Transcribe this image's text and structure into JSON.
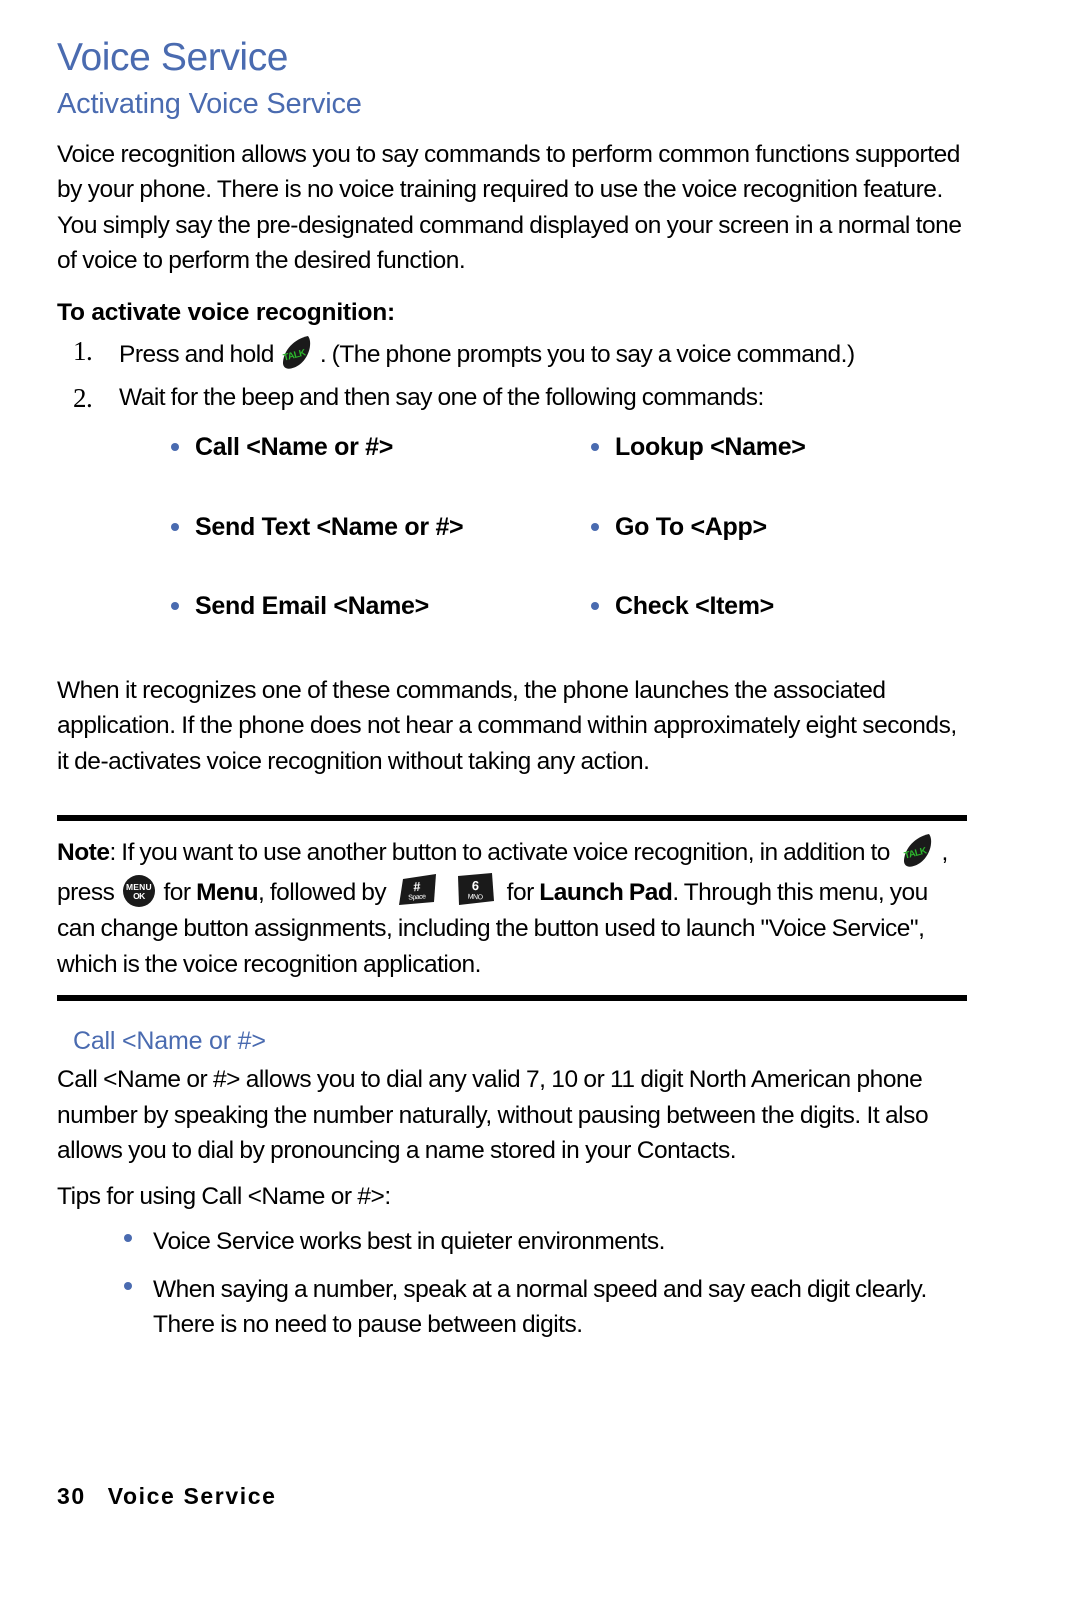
{
  "page": {
    "title": "Voice Service",
    "section_heading": "Activating Voice Service",
    "intro_paragraph": "Voice recognition allows you to say commands to perform common functions supported by your phone. There is no voice training required to use the voice recognition feature. You simply say the pre-designated command displayed on your screen in a normal tone of voice to perform the desired function.",
    "procedure_heading": "To activate voice recognition:",
    "accent_color": "#4a6bb0",
    "key_green": "#2db72d"
  },
  "steps": [
    {
      "number": "1.",
      "text_before": "Press and hold",
      "icon": "talk-key-icon",
      "text_after": ". (The phone prompts you to say a voice command.)"
    },
    {
      "number": "2.",
      "text_before": "Wait for the beep and then say one of the following commands:",
      "icon": "",
      "text_after": ""
    }
  ],
  "commands": [
    "Call <Name or #>",
    "Lookup <Name>",
    "Send Text <Name or #>",
    "Go To <App>",
    "Send Email <Name>",
    "Check <Item>"
  ],
  "recognition_paragraph": "When it recognizes one of these commands, the phone launches the associated application. If the phone does not hear a command within approximately eight seconds, it de-activates voice recognition without taking any action.",
  "note": {
    "label": "Note",
    "part1": ": If you want to use another button to activate voice recognition, in addition to",
    "part2": ", press",
    "part3": "for",
    "bold1": "Menu",
    "part4": ", followed by",
    "part5": "for",
    "bold2": "Launch Pad",
    "part6": ". Through this menu, you can change button assignments, including the button used to launch \"Voice Service\", which is the voice recognition application."
  },
  "keys": {
    "talk": {
      "label": "TALK",
      "name": "talk-key-icon"
    },
    "menu": {
      "line1": "MENU",
      "line2": "OK",
      "name": "menu-ok-key-icon"
    },
    "hash": {
      "line1": "#",
      "line2": "Space",
      "name": "hash-space-key-icon"
    },
    "six": {
      "line1": "6",
      "line2": "MNO",
      "name": "six-mno-key-icon"
    }
  },
  "call_section": {
    "heading": "Call <Name or #>",
    "paragraph": "Call <Name or #> allows you to dial any valid 7, 10 or 11 digit North American phone number by speaking the number naturally, without pausing between the digits. It also allows you to dial by pronouncing a name stored in your Contacts.",
    "tips_intro": "Tips for using Call <Name or #>:",
    "tips": [
      "Voice Service works best in quieter environments.",
      "When saying a number, speak at a normal speed and say each digit clearly. There is no need to pause between digits."
    ]
  },
  "footer": {
    "page_number": "30",
    "chapter": "Voice Service"
  }
}
